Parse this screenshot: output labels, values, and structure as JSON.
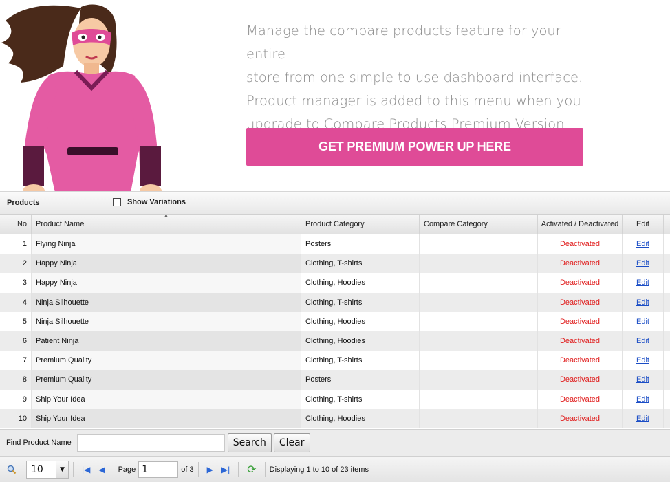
{
  "promo": {
    "lines": [
      "Manage the compare products feature for your entire",
      "store from one simple to use dashboard interface.",
      "Product manager is added to this menu when you",
      "upgrade to Compare Products Premium Version"
    ],
    "button_label": "GET PREMIUM POWER UP HERE",
    "accent_color": "#df4b97"
  },
  "grid": {
    "title": "Products",
    "show_variations_label": "Show Variations",
    "show_variations_checked": false,
    "columns": [
      "No",
      "Product Name",
      "Product Category",
      "Compare Category",
      "Activated / Deactivated",
      "Edit"
    ],
    "rows": [
      {
        "no": "1",
        "name": "Flying Ninja",
        "product_category": "Posters",
        "compare_category": "",
        "status": "Deactivated",
        "edit": "Edit"
      },
      {
        "no": "2",
        "name": "Happy Ninja",
        "product_category": "Clothing, T-shirts",
        "compare_category": "",
        "status": "Deactivated",
        "edit": "Edit"
      },
      {
        "no": "3",
        "name": "Happy Ninja",
        "product_category": "Clothing, Hoodies",
        "compare_category": "",
        "status": "Deactivated",
        "edit": "Edit"
      },
      {
        "no": "4",
        "name": "Ninja Silhouette",
        "product_category": "Clothing, T-shirts",
        "compare_category": "",
        "status": "Deactivated",
        "edit": "Edit"
      },
      {
        "no": "5",
        "name": "Ninja Silhouette",
        "product_category": "Clothing, Hoodies",
        "compare_category": "",
        "status": "Deactivated",
        "edit": "Edit"
      },
      {
        "no": "6",
        "name": "Patient Ninja",
        "product_category": "Clothing, Hoodies",
        "compare_category": "",
        "status": "Deactivated",
        "edit": "Edit"
      },
      {
        "no": "7",
        "name": "Premium Quality",
        "product_category": "Clothing, T-shirts",
        "compare_category": "",
        "status": "Deactivated",
        "edit": "Edit"
      },
      {
        "no": "8",
        "name": "Premium Quality",
        "product_category": "Posters",
        "compare_category": "",
        "status": "Deactivated",
        "edit": "Edit"
      },
      {
        "no": "9",
        "name": "Ship Your Idea",
        "product_category": "Clothing, T-shirts",
        "compare_category": "",
        "status": "Deactivated",
        "edit": "Edit"
      },
      {
        "no": "10",
        "name": "Ship Your Idea",
        "product_category": "Clothing, Hoodies",
        "compare_category": "",
        "status": "Deactivated",
        "edit": "Edit"
      }
    ],
    "status_color": "#e01b1b"
  },
  "search": {
    "label": "Find Product Name",
    "value": "",
    "search_button": "Search",
    "clear_button": "Clear"
  },
  "pager": {
    "per_page": "10",
    "page_label": "Page",
    "page_value": "1",
    "of_label": "of 3",
    "display_text": "Displaying 1 to 10 of 23 items"
  }
}
